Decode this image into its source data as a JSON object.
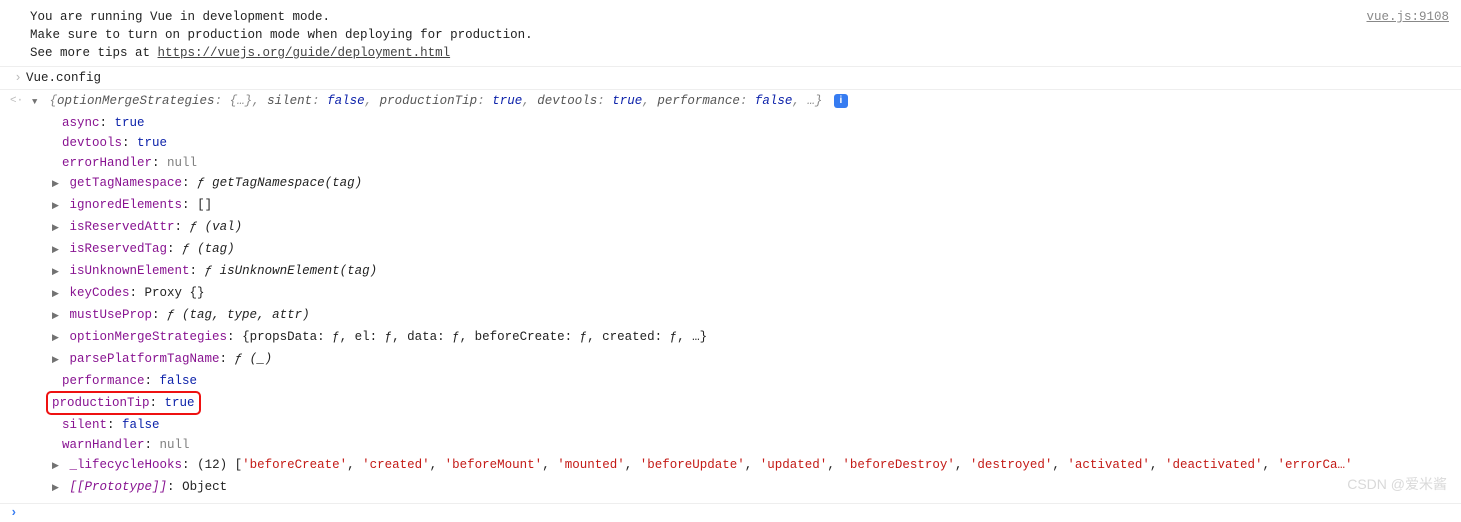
{
  "source": "vue.js:9108",
  "warn": {
    "l1": "You are running Vue in development mode.",
    "l2": "Make sure to turn on production mode when deploying for production.",
    "l3a": "See more tips at ",
    "l3link": "https://vuejs.org/guide/deployment.html"
  },
  "expr": "Vue.config",
  "preview": {
    "open": "{",
    "p1k": "optionMergeStrategies",
    "p1v": "{…}",
    "p2k": "silent",
    "p2v": "false",
    "p3k": "productionTip",
    "p3v": "true",
    "p4k": "devtools",
    "p4v": "true",
    "p5k": "performance",
    "p5v": "false",
    "close": ", …}"
  },
  "props": {
    "async_k": "async",
    "async_v": "true",
    "devtools_k": "devtools",
    "devtools_v": "true",
    "errorHandler_k": "errorHandler",
    "errorHandler_v": "null",
    "getTagNamespace_k": "getTagNamespace",
    "getTagNamespace_v": "ƒ getTagNamespace(tag)",
    "ignoredElements_k": "ignoredElements",
    "ignoredElements_v": "[]",
    "isReservedAttr_k": "isReservedAttr",
    "isReservedAttr_v": "ƒ (val)",
    "isReservedTag_k": "isReservedTag",
    "isReservedTag_v": "ƒ (tag)",
    "isUnknownElement_k": "isUnknownElement",
    "isUnknownElement_v": "ƒ isUnknownElement(tag)",
    "keyCodes_k": "keyCodes",
    "keyCodes_v": "Proxy {}",
    "mustUseProp_k": "mustUseProp",
    "mustUseProp_v": "ƒ (tag, type, attr)",
    "optionMergeStrategies_k": "optionMergeStrategies",
    "optionMergeStrategies_v": "{propsData: ƒ, el: ƒ, data: ƒ, beforeCreate: ƒ, created: ƒ, …}",
    "parsePlatformTagName_k": "parsePlatformTagName",
    "parsePlatformTagName_v": "ƒ (_)",
    "performance_k": "performance",
    "performance_v": "false",
    "productionTip_k": "productionTip",
    "productionTip_v": "true",
    "silent_k": "silent",
    "silent_v": "false",
    "warnHandler_k": "warnHandler",
    "warnHandler_v": "null",
    "lifecycle_k": "_lifecycleHooks",
    "lifecycle_len": "(12) ",
    "lifecycle_items": [
      "beforeCreate",
      "created",
      "beforeMount",
      "mounted",
      "beforeUpdate",
      "updated",
      "beforeDestroy",
      "destroyed",
      "activated",
      "deactivated",
      "errorCa…"
    ],
    "proto_k": "[[Prototype]]",
    "proto_v": "Object"
  },
  "watermark": "CSDN @爱米酱"
}
